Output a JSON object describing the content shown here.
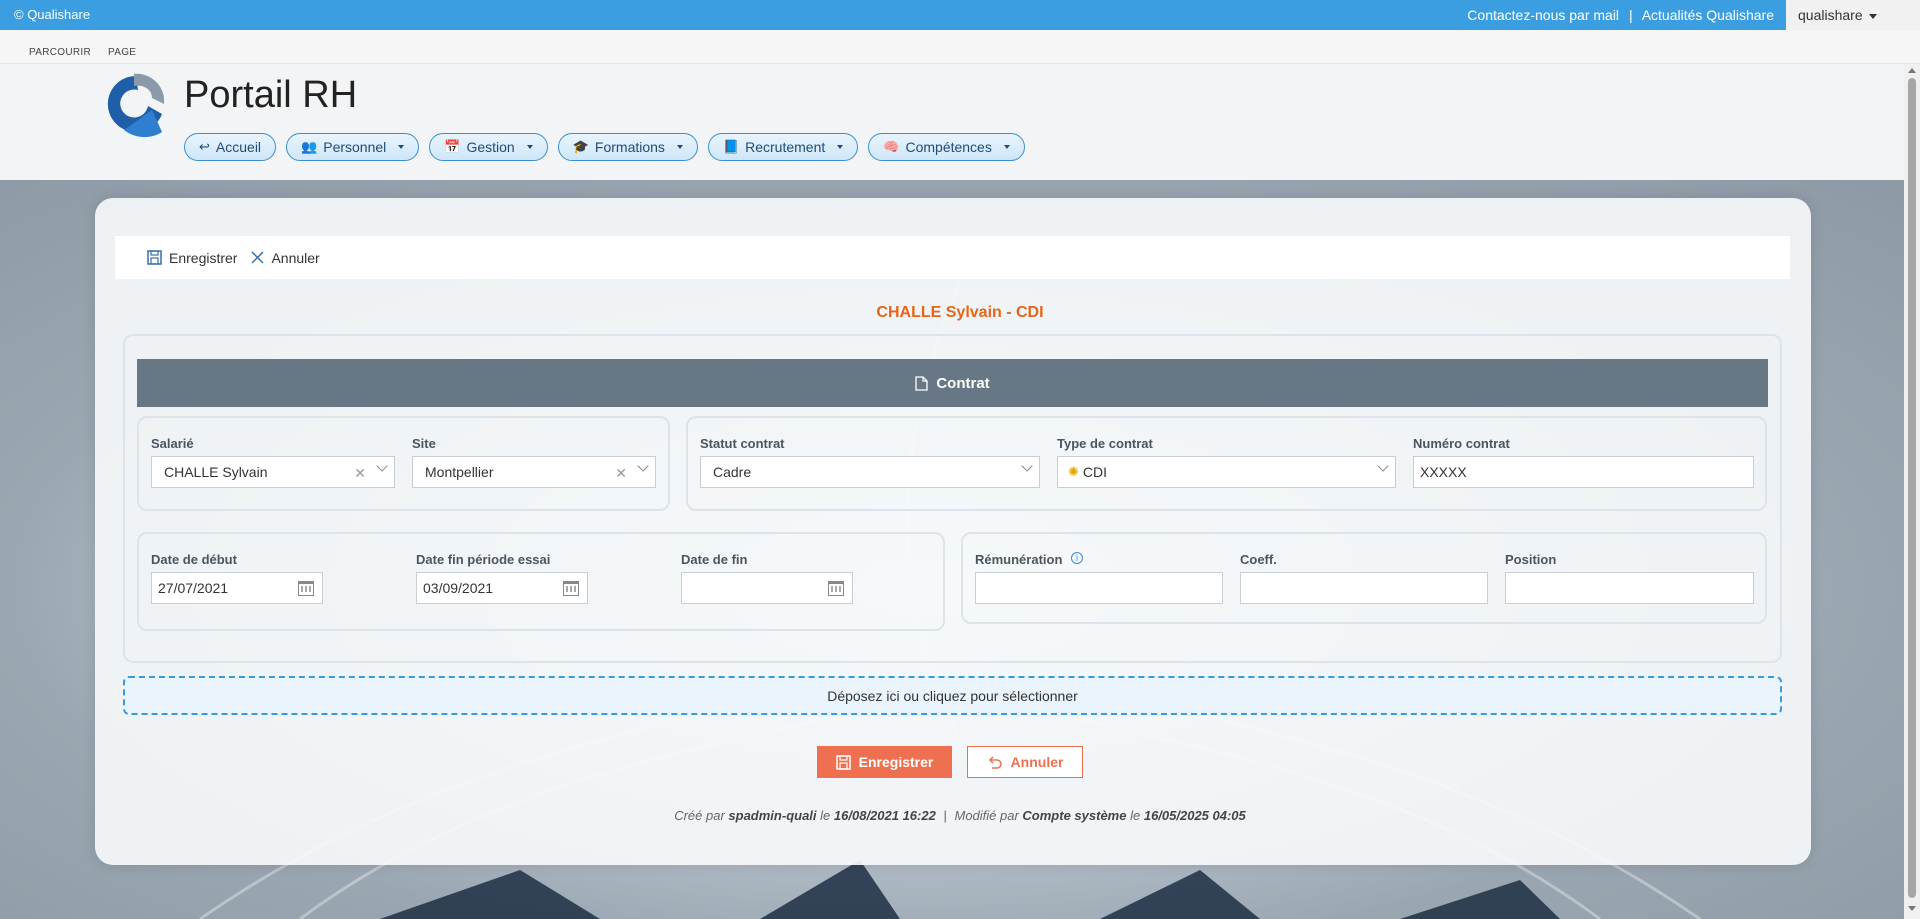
{
  "topbar": {
    "brand": "© Qualishare",
    "link_contact": "Contactez-nous par mail",
    "separator": "|",
    "link_news": "Actualités Qualishare",
    "user": "qualishare"
  },
  "ribbon": {
    "browse": "PARCOURIR",
    "page": "PAGE"
  },
  "header": {
    "title": "Portail RH",
    "nav": [
      {
        "label": "Accueil",
        "icon": "return-arrow-icon"
      },
      {
        "label": "Personnel",
        "icon": "people-icon"
      },
      {
        "label": "Gestion",
        "icon": "calendar-icon"
      },
      {
        "label": "Formations",
        "icon": "training-icon"
      },
      {
        "label": "Recrutement",
        "icon": "book-icon"
      },
      {
        "label": "Compétences",
        "icon": "brain-icon"
      }
    ]
  },
  "toolbar": {
    "save": "Enregistrer",
    "cancel": "Annuler"
  },
  "form": {
    "title": "CHALLE Sylvain - CDI",
    "section": "Contrat",
    "salarie": {
      "label": "Salarié",
      "value": "CHALLE Sylvain"
    },
    "site": {
      "label": "Site",
      "value": "Montpellier"
    },
    "statut": {
      "label": "Statut contrat",
      "value": "Cadre"
    },
    "type": {
      "label": "Type de contrat",
      "value": "CDI"
    },
    "numero": {
      "label": "Numéro contrat",
      "value": "XXXXX"
    },
    "debut": {
      "label": "Date de début",
      "value": "27/07/2021"
    },
    "essai": {
      "label": "Date fin période essai",
      "value": "03/09/2021"
    },
    "fin": {
      "label": "Date de fin",
      "value": ""
    },
    "remuneration": {
      "label": "Rémunération",
      "value": ""
    },
    "coeff": {
      "label": "Coeff.",
      "value": ""
    },
    "position": {
      "label": "Position",
      "value": ""
    },
    "dropzone": "Déposez ici ou cliquez pour sélectionner",
    "save_button": "Enregistrer",
    "cancel_button": "Annuler"
  },
  "audit": {
    "created_prefix": "Créé par",
    "created_by": "spadmin-quali",
    "created_le": "le",
    "created_at": "16/08/2021 16:22",
    "sep": "|",
    "modified_prefix": "Modifié par",
    "modified_by": "Compte système",
    "modified_le": "le",
    "modified_at": "16/05/2025 04:05"
  },
  "colors": {
    "topbar": "#3b9ee1",
    "accent": "#ef7050",
    "title": "#e8641b",
    "section": "#677785"
  }
}
